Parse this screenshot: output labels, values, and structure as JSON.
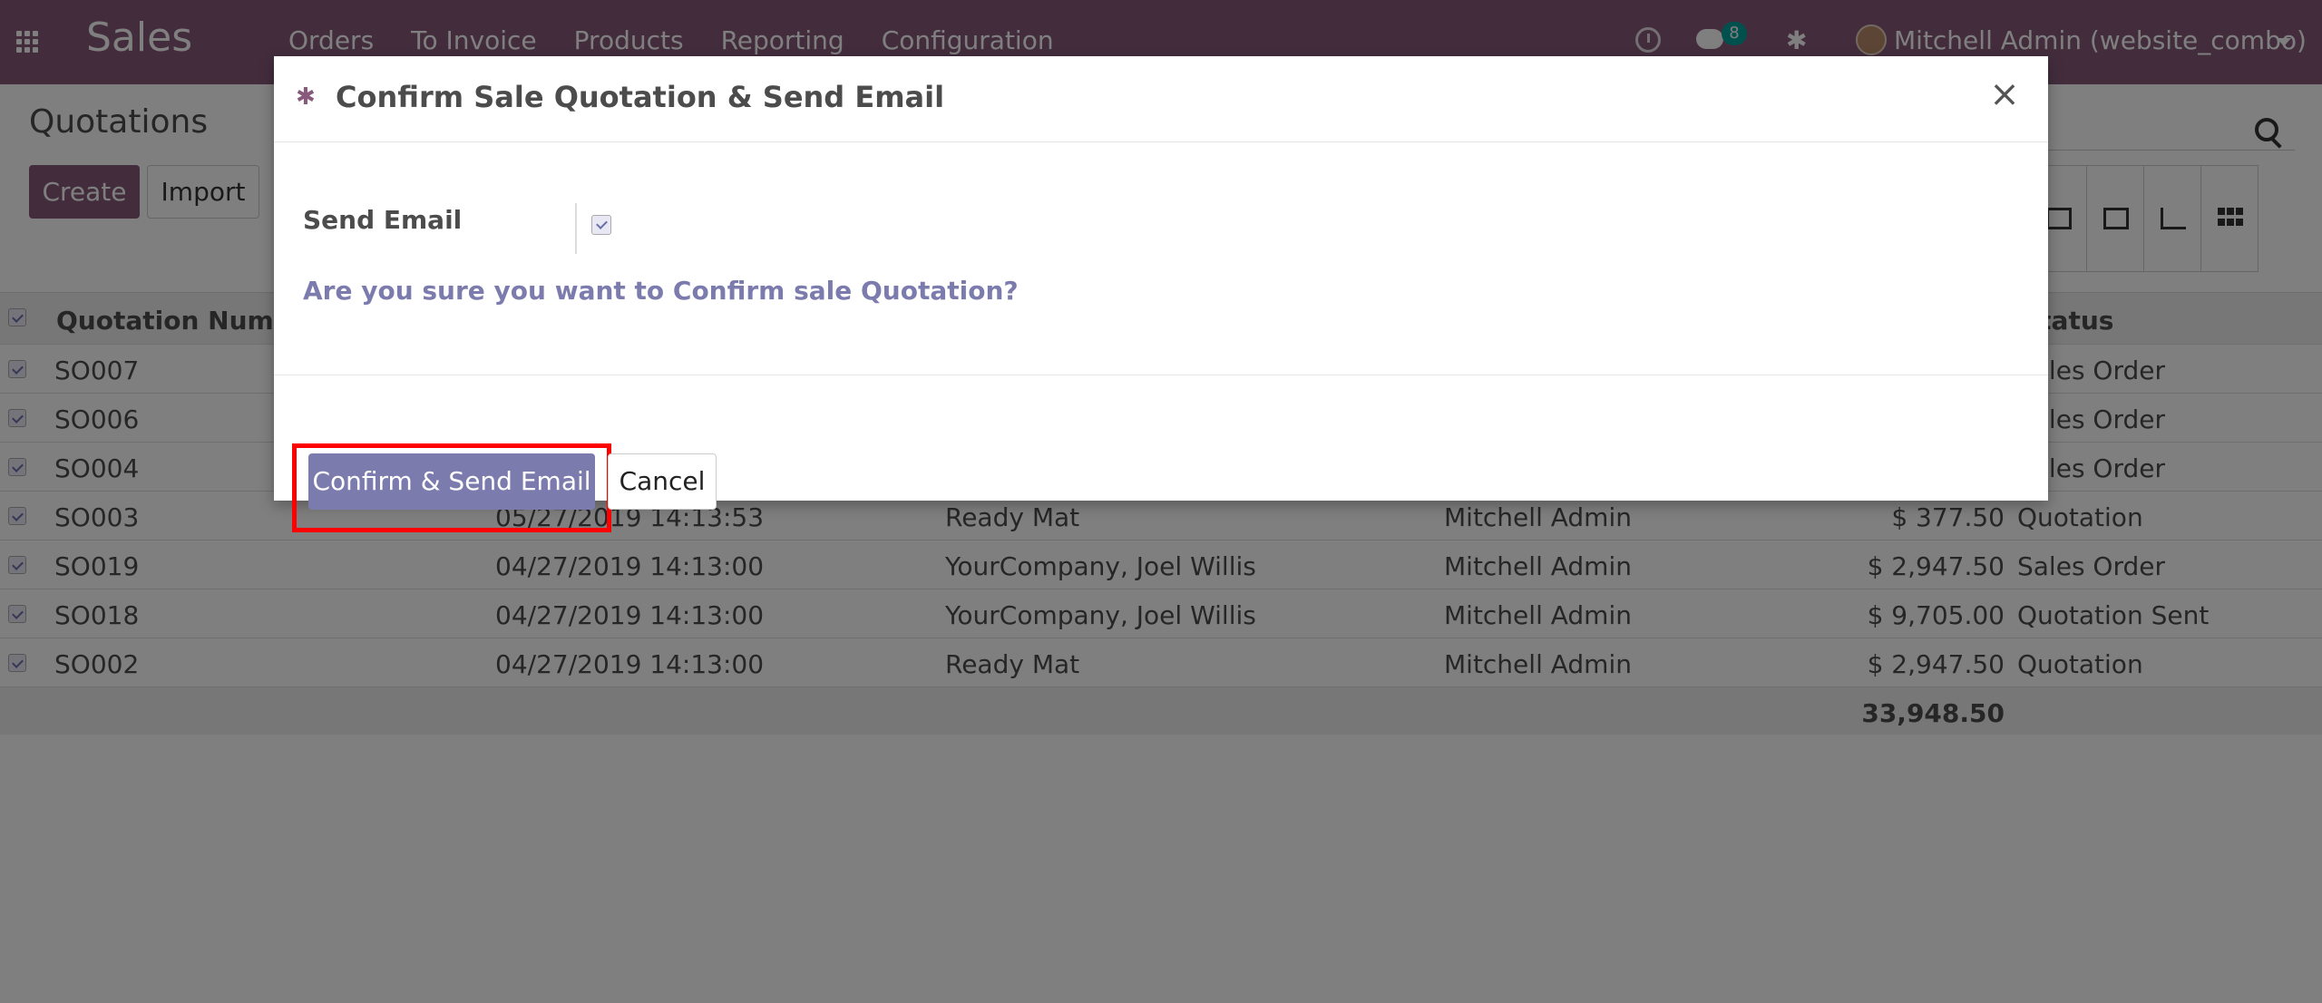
{
  "navbar": {
    "app_name": "Sales",
    "menu": [
      "Orders",
      "To Invoice",
      "Products",
      "Reporting",
      "Configuration"
    ],
    "messages_badge": "8",
    "user": "Mitchell Admin (website_combo)",
    "color": "#875a7b"
  },
  "control_panel": {
    "title": "Quotations",
    "create_label": "Create",
    "import_label": "Import",
    "views": [
      "calendar-icon",
      "pivot-icon",
      "graph-icon",
      "kanban-icon"
    ]
  },
  "table": {
    "headers": {
      "number": "Quotation Number",
      "status": "Status"
    },
    "rows": [
      {
        "number": "SO007",
        "date": "",
        "customer": "",
        "salesperson": "",
        "total": "",
        "status": "Sales Order"
      },
      {
        "number": "SO006",
        "date": "",
        "customer": "",
        "salesperson": "",
        "total": "",
        "status": "Sales Order"
      },
      {
        "number": "SO004",
        "date": "",
        "customer": "",
        "salesperson": "",
        "total": "",
        "status": "Sales Order"
      },
      {
        "number": "SO003",
        "date": "05/27/2019 14:13:53",
        "customer": "Ready Mat",
        "salesperson": "Mitchell Admin",
        "total": "$ 377.50",
        "status": "Quotation"
      },
      {
        "number": "SO019",
        "date": "04/27/2019 14:13:00",
        "customer": "YourCompany, Joel Willis",
        "salesperson": "Mitchell Admin",
        "total": "$ 2,947.50",
        "status": "Sales Order"
      },
      {
        "number": "SO018",
        "date": "04/27/2019 14:13:00",
        "customer": "YourCompany, Joel Willis",
        "salesperson": "Mitchell Admin",
        "total": "$ 9,705.00",
        "status": "Quotation Sent"
      },
      {
        "number": "SO002",
        "date": "04/27/2019 14:13:00",
        "customer": "Ready Mat",
        "salesperson": "Mitchell Admin",
        "total": "$ 2,947.50",
        "status": "Quotation"
      }
    ],
    "grand_total": "33,948.50"
  },
  "modal": {
    "title": "Confirm Sale Quotation & Send Email",
    "field_label": "Send Email",
    "send_email_checked": true,
    "question": "Are you sure you want to Confirm sale Quotation?",
    "confirm_label": "Confirm & Send Email",
    "cancel_label": "Cancel",
    "accent": "#7c7bad",
    "highlight_color": "#ff0000"
  }
}
